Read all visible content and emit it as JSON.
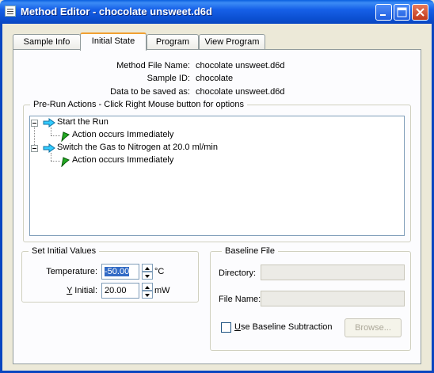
{
  "window": {
    "title": "Method Editor - chocolate unsweet.d6d"
  },
  "tabs": [
    {
      "label": "Sample Info"
    },
    {
      "label": "Initial State"
    },
    {
      "label": "Program"
    },
    {
      "label": "View Program"
    }
  ],
  "info": {
    "method_file_label": "Method File Name:",
    "method_file_value": "chocolate unsweet.d6d",
    "sample_id_label": "Sample ID:",
    "sample_id_value": "chocolate",
    "data_saved_label": "Data to be saved as:",
    "data_saved_value": "chocolate unsweet.d6d"
  },
  "prerun": {
    "title": "Pre-Run Actions - Click Right Mouse button for options",
    "items": [
      {
        "label": "Start the Run",
        "child": "Action occurs Immediately"
      },
      {
        "label": "Switch the Gas to Nitrogen at 20.0 ml/min",
        "child": "Action occurs Immediately"
      }
    ]
  },
  "initial_values": {
    "title": "Set Initial Values",
    "temperature_label": "Temperature:",
    "temperature_value": "-50.00",
    "temperature_unit": "°C",
    "y_initial_label_prefix": "Y",
    "y_initial_label_rest": " Initial:",
    "y_initial_value": "20.00",
    "y_initial_unit": "mW"
  },
  "baseline": {
    "title": "Baseline File",
    "directory_label": "Directory:",
    "directory_value": "",
    "filename_label": "File Name:",
    "filename_value": "",
    "subtraction_label_prefix": "U",
    "subtraction_label_rest": "se Baseline Subtraction",
    "browse_label": "Browse..."
  },
  "colors": {
    "titlebar": "#0a4fd0",
    "tab_highlight": "#f1a033",
    "selection": "#316ac5"
  }
}
